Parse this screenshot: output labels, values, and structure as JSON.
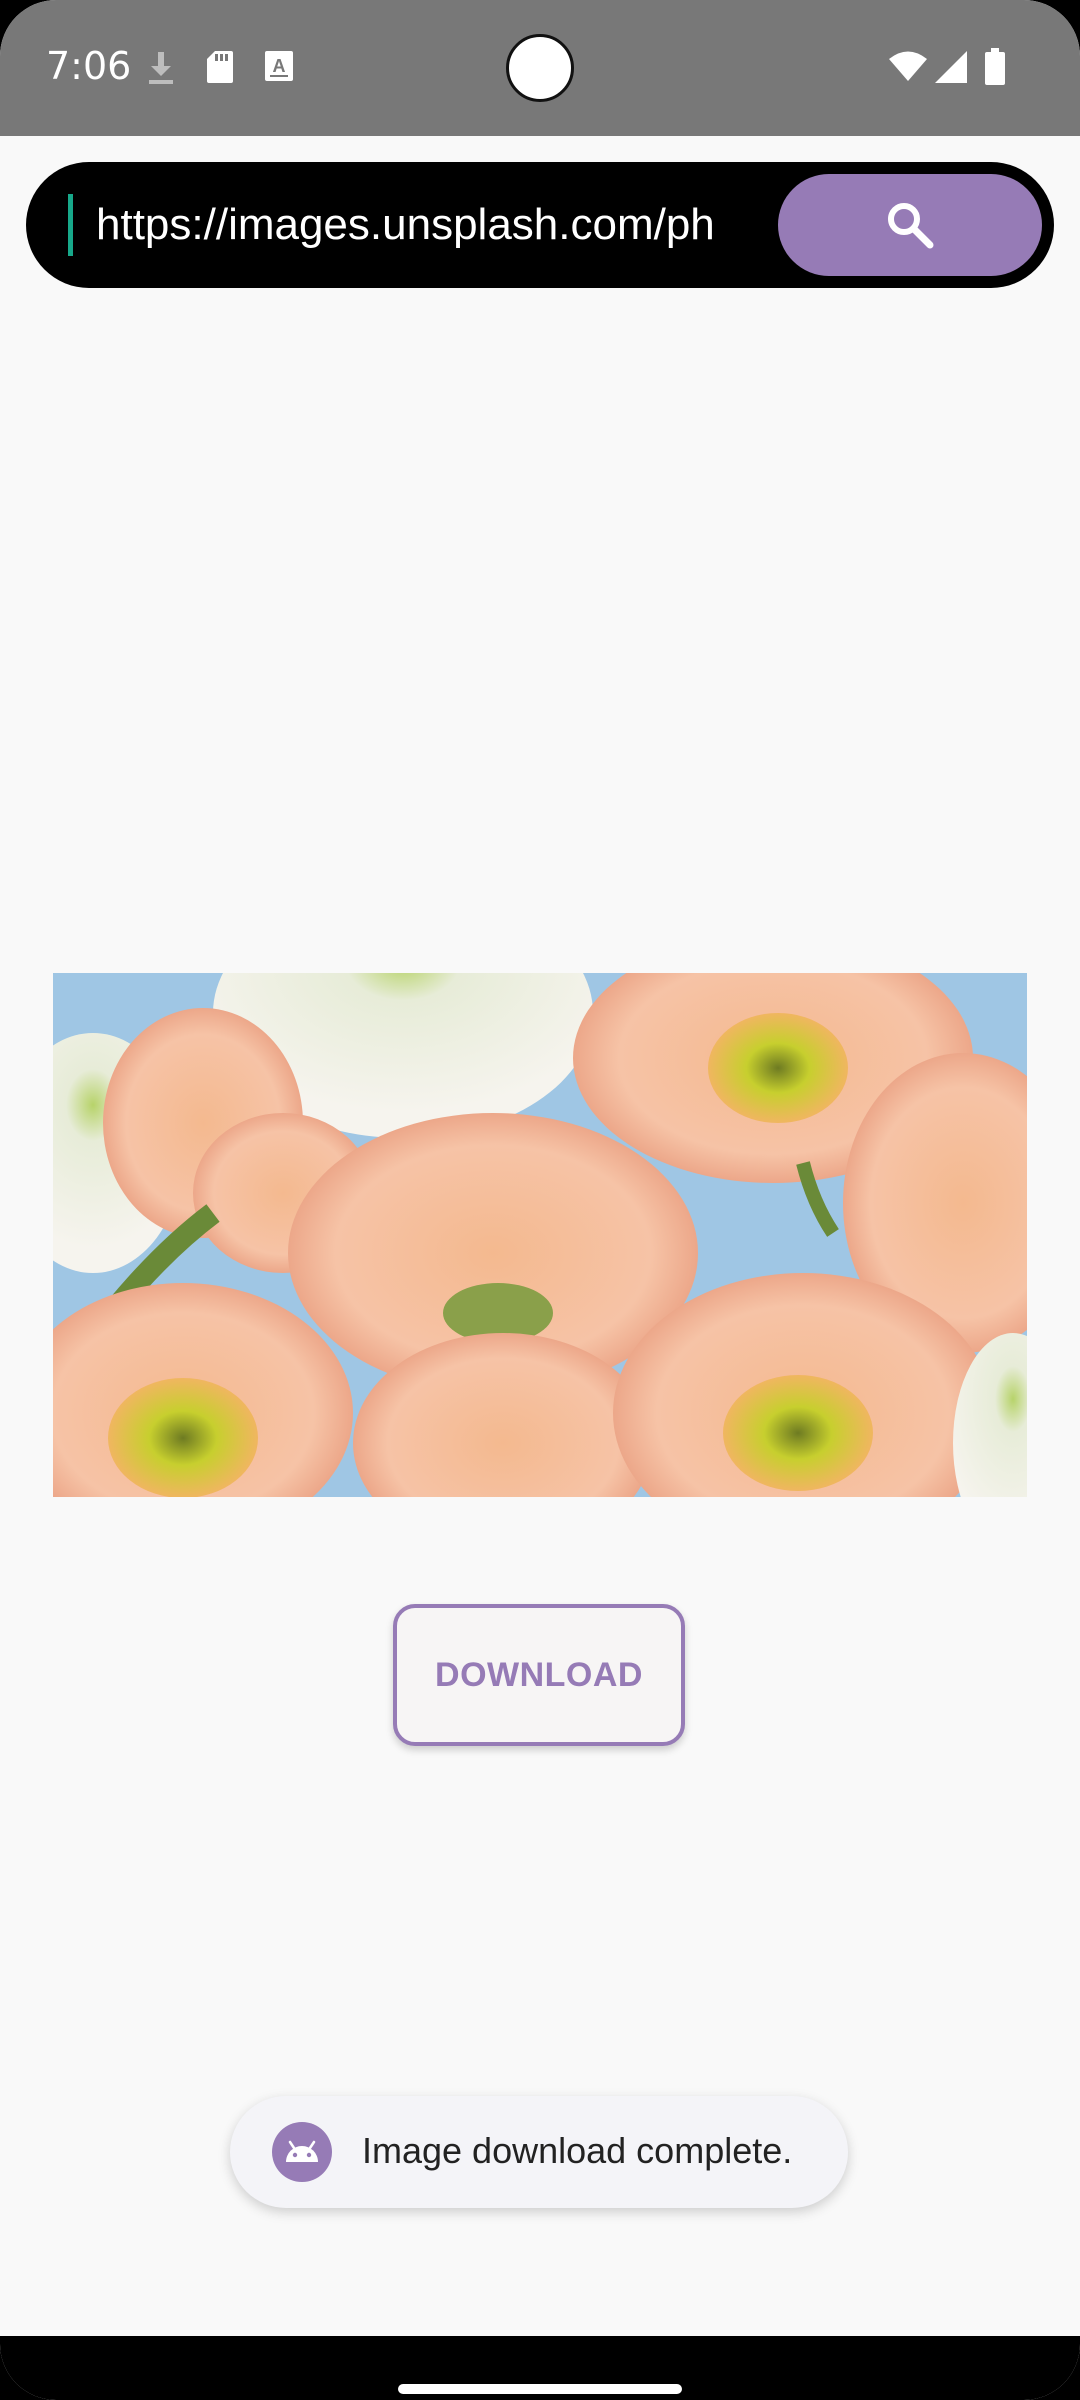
{
  "status_bar": {
    "time": "7:06",
    "icons": [
      "download-icon",
      "sd-card-icon",
      "font-icon",
      "wifi-icon",
      "signal-icon",
      "battery-icon"
    ]
  },
  "url_bar": {
    "value": "https://images.unsplash.com/ph",
    "search_icon": "search-icon"
  },
  "download_button": {
    "label": "DOWNLOAD"
  },
  "toast": {
    "text": "Image download complete.",
    "icon": "android-icon"
  },
  "colors": {
    "accent": "#967bb6",
    "status_bar": "#787878",
    "background": "#f9f9f9"
  }
}
